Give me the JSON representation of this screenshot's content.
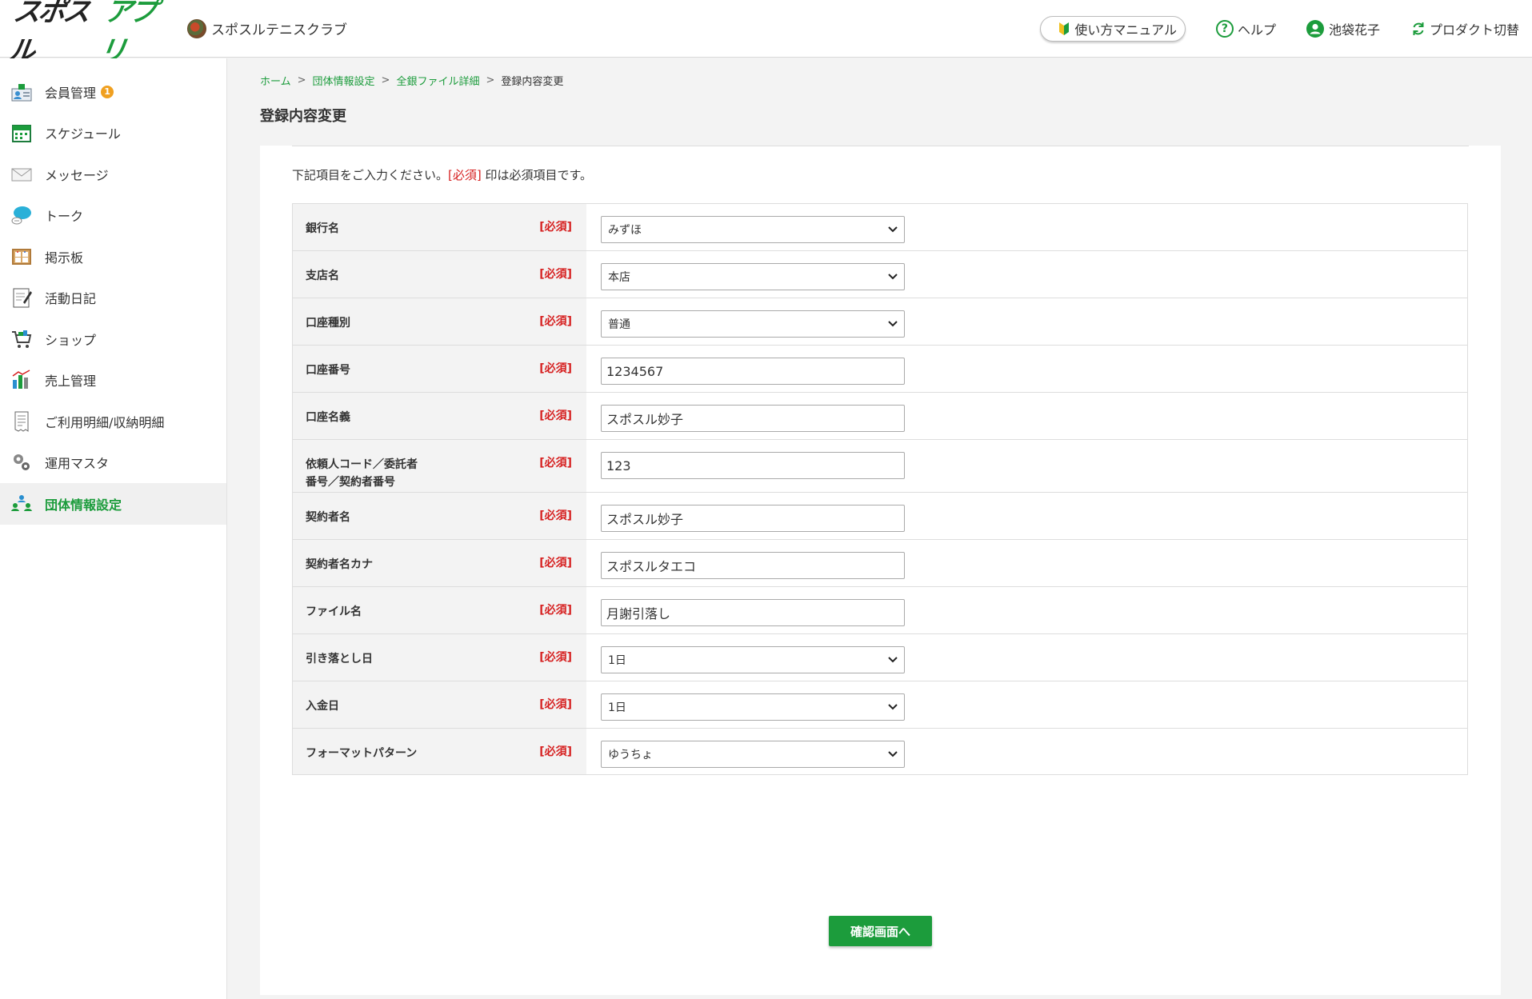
{
  "header": {
    "logo_black": "スポスル",
    "logo_green": "アプリ",
    "club_name": "スポスルテニスクラブ",
    "manual_label": "使い方マニュアル",
    "help_label": "ヘルプ",
    "user_name": "池袋花子",
    "switch_label": "プロダクト切替"
  },
  "sidebar": {
    "items": [
      {
        "label": "会員管理",
        "icon": "members-icon",
        "badge": "1"
      },
      {
        "label": "スケジュール",
        "icon": "calendar-icon"
      },
      {
        "label": "メッセージ",
        "icon": "mail-icon"
      },
      {
        "label": "トーク",
        "icon": "chat-icon"
      },
      {
        "label": "掲示板",
        "icon": "board-icon"
      },
      {
        "label": "活動日記",
        "icon": "diary-icon"
      },
      {
        "label": "ショップ",
        "icon": "cart-icon"
      },
      {
        "label": "売上管理",
        "icon": "sales-icon"
      },
      {
        "label": "ご利用明細/収納明細",
        "icon": "receipt-icon"
      },
      {
        "label": "運用マスタ",
        "icon": "gears-icon"
      },
      {
        "label": "団体情報設定",
        "icon": "group-settings-icon",
        "active": true
      }
    ]
  },
  "breadcrumb": {
    "home": "ホーム",
    "group_settings": "団体情報設定",
    "bank_file_detail": "全銀ファイル詳細",
    "current": "登録内容変更",
    "separator": ">"
  },
  "page": {
    "title": "登録内容変更",
    "intro_before": "下記項目をご入力ください。",
    "intro_req": "[必須]",
    "intro_after": " 印は必須項目です。",
    "required_tag": "[必須]",
    "confirm_button": "確認画面へ"
  },
  "form": {
    "bank_name": {
      "label": "銀行名",
      "value": "みずほ"
    },
    "branch_name": {
      "label": "支店名",
      "value": "本店"
    },
    "account_type": {
      "label": "口座種別",
      "value": "普通"
    },
    "account_number": {
      "label": "口座番号",
      "value": "1234567"
    },
    "account_holder": {
      "label": "口座名義",
      "value": "スポスル妙子"
    },
    "requester_code_line1": "依頼人コード／委託者",
    "requester_code_line2": "番号／契約者番号",
    "requester_code_value": "123",
    "contractor_name": {
      "label": "契約者名",
      "value": "スポスル妙子"
    },
    "contractor_kana": {
      "label": "契約者名カナ",
      "value": "スポスルタエコ"
    },
    "file_name": {
      "label": "ファイル名",
      "value": "月謝引落し"
    },
    "withdrawal_day": {
      "label": "引き落とし日",
      "value": "1日"
    },
    "deposit_day": {
      "label": "入金日",
      "value": "1日"
    },
    "format_pattern": {
      "label": "フォーマットパターン",
      "value": "ゆうちょ"
    }
  },
  "colors": {
    "brand_green": "#1c9c3c",
    "required_red": "#d62020",
    "badge_orange": "#f0a020"
  }
}
